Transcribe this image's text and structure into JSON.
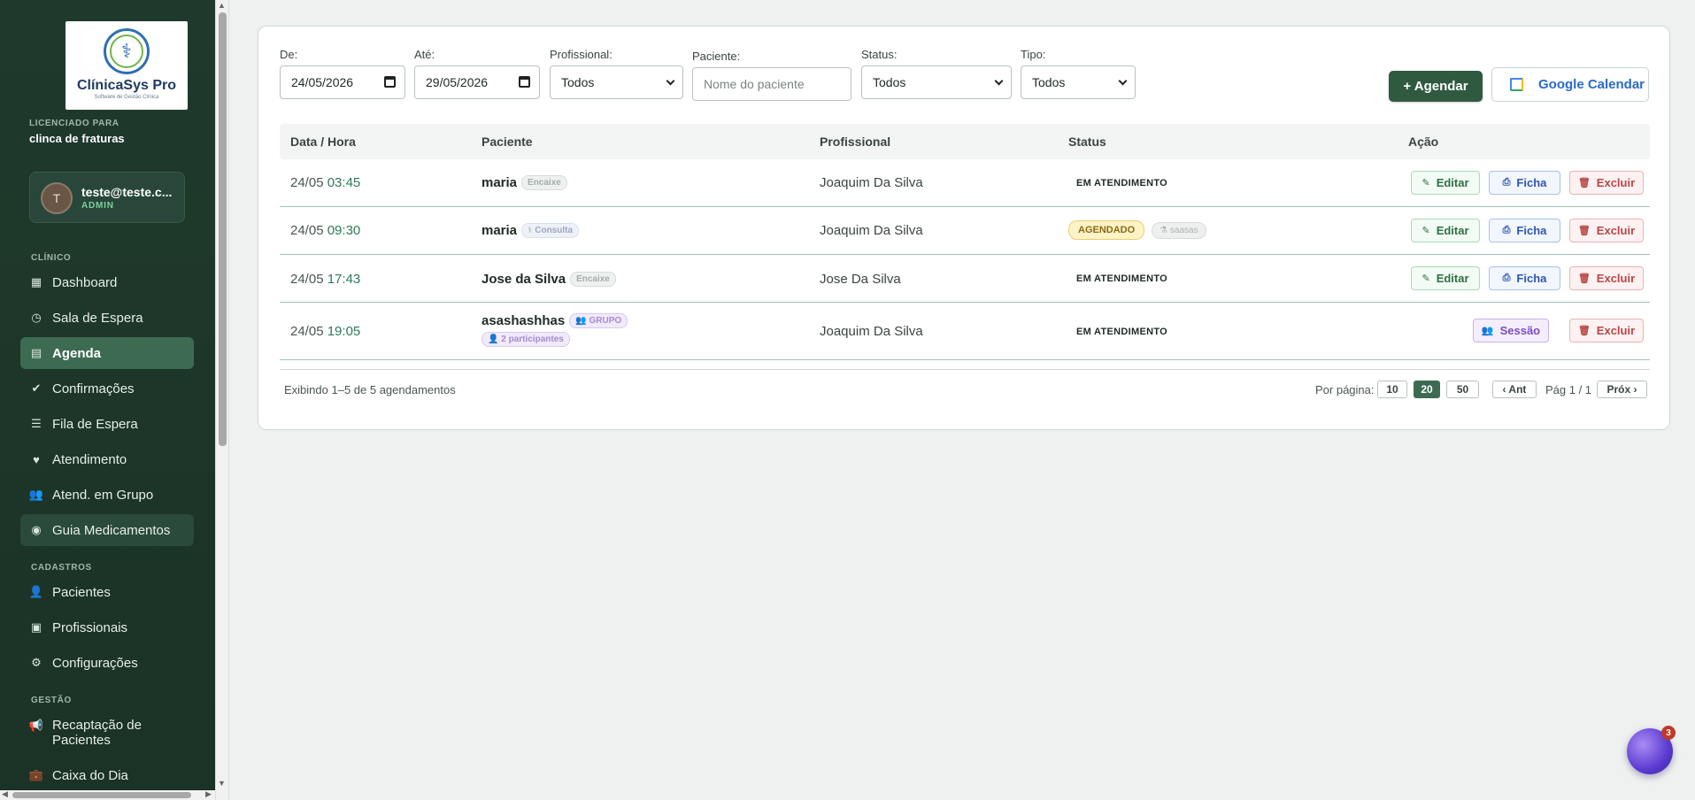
{
  "brand": {
    "name": "ClínicaSys Pro",
    "tagline": "Software de Gestão Clínica"
  },
  "license": {
    "label": "LICENCIADO PARA",
    "name": "clinca de fraturas"
  },
  "user": {
    "initial": "T",
    "email": "teste@teste.c...",
    "role": "ADMIN"
  },
  "sidebar": {
    "sections": [
      {
        "label": "CLÍNICO",
        "items": [
          {
            "label": "Dashboard",
            "icon": "grid-icon"
          },
          {
            "label": "Sala de Espera",
            "icon": "clock-icon"
          },
          {
            "label": "Agenda",
            "icon": "calendar-icon",
            "active": true
          },
          {
            "label": "Confirmações",
            "icon": "check-circle-icon"
          },
          {
            "label": "Fila de Espera",
            "icon": "list-check-icon"
          },
          {
            "label": "Atendimento",
            "icon": "heart-pulse-icon"
          },
          {
            "label": "Atend. em Grupo",
            "icon": "users-icon"
          },
          {
            "label": "Guia Medicamentos",
            "icon": "pills-icon"
          }
        ]
      },
      {
        "label": "CADASTROS",
        "items": [
          {
            "label": "Pacientes",
            "icon": "user-icon"
          },
          {
            "label": "Profissionais",
            "icon": "id-badge-icon"
          },
          {
            "label": "Configurações",
            "icon": "gear-icon"
          }
        ]
      },
      {
        "label": "GESTÃO",
        "items": [
          {
            "label": "Recaptação de Pacientes",
            "line1": "Recaptação de",
            "line2": "Pacientes",
            "icon": "megaphone-icon"
          },
          {
            "label": "Caixa do Dia",
            "icon": "briefcase-icon"
          }
        ]
      }
    ]
  },
  "filters": {
    "from": {
      "label": "De:",
      "value": "24/05/2026"
    },
    "to": {
      "label": "Até:",
      "value": "29/05/2026"
    },
    "professional": {
      "label": "Profissional:",
      "value": "Todos"
    },
    "patient": {
      "label": "Paciente:",
      "placeholder": "Nome do paciente"
    },
    "status": {
      "label": "Status:",
      "value": "Todos"
    },
    "type": {
      "label": "Tipo:",
      "value": "Todos"
    }
  },
  "actions": {
    "schedule": "+ Agendar",
    "google_calendar": "Google Calendar"
  },
  "table": {
    "headers": {
      "datetime": "Data / Hora",
      "patient": "Paciente",
      "professional": "Profissional",
      "status": "Status",
      "action": "Ação"
    },
    "rows": [
      {
        "date": "24/05",
        "time": "03:45",
        "patient": "maria",
        "tag": "Encaixe",
        "professional": "Joaquim Da Silva",
        "status": "EM ATENDIMENTO"
      },
      {
        "date": "24/05",
        "time": "09:30",
        "patient": "maria",
        "tag": "Consulta",
        "professional": "Joaquim Da Silva",
        "status": "AGENDADO",
        "status_tag": "saasas"
      },
      {
        "date": "24/05",
        "time": "17:43",
        "patient": "Jose da Silva",
        "tag": "Encaixe",
        "professional": "Jose Da Silva",
        "status": "EM ATENDIMENTO"
      },
      {
        "date": "24/05",
        "time": "19:05",
        "patient": "asashashhas",
        "tag": "GRUPO",
        "participants": "2 participantes",
        "professional": "Joaquim Da Silva",
        "status": "EM ATENDIMENTO"
      }
    ],
    "row_actions": {
      "edit": "Editar",
      "sheet": "Ficha",
      "delete": "Excluir",
      "session": "Sessão"
    }
  },
  "pagination": {
    "summary": "Exibindo 1–5 de 5 agendamentos",
    "per_page_label": "Por página:",
    "sizes": [
      "10",
      "20",
      "50"
    ],
    "selected": "20",
    "prev": "‹ Ant",
    "page_info": "Pág 1 / 1",
    "next": "Próx ›"
  },
  "assistant": {
    "badge": "3"
  },
  "colors": {
    "sidebar": "#1f3a2c",
    "accent": "#2f5a40",
    "active_nav": "#3d6b52"
  }
}
